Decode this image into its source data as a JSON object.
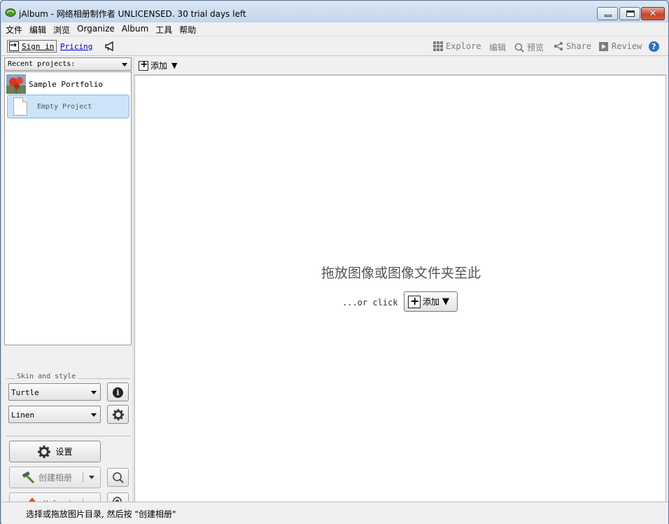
{
  "window": {
    "title": "jAlbum - 网络相册制作者 UNLICENSED. 30 trial days left",
    "close_glyph": "✕"
  },
  "menu": [
    "文件",
    "编辑",
    "浏览",
    "Organize",
    "Album",
    "工具",
    "帮助"
  ],
  "toolbar": {
    "signin_label": "Sign in",
    "pricing_label": "Pricing",
    "right": [
      {
        "icon": "grid-icon",
        "label": "Explore"
      },
      {
        "icon": "edit-icon",
        "label": "编辑"
      },
      {
        "icon": "preview-icon",
        "label": "预览"
      },
      {
        "icon": "share-icon",
        "label": "Share"
      },
      {
        "icon": "play-icon",
        "label": "Review"
      }
    ],
    "help_label": "?"
  },
  "left": {
    "recent_label": "Recent projects:",
    "projects": [
      {
        "name": "Sample Portfolio"
      },
      {
        "name": "Empty Project"
      }
    ],
    "skin_legend": "Skin and style",
    "skin_value": "Turtle",
    "style_value": "Linen",
    "settings_label": "设置",
    "make_album_label": "创建相册",
    "upload_label": "Upload"
  },
  "right": {
    "add_label": "添加",
    "drop_text": "拖放图像或图像文件夹至此",
    "or_click": "...or click",
    "add_center_label": "添加"
  },
  "status": {
    "text": "选择或拖放图片目录, 然后按 \"创建相册\""
  },
  "colors": {
    "accent": "#2f6fc7",
    "selection": "#cce4f9",
    "link": "#0000cc"
  }
}
